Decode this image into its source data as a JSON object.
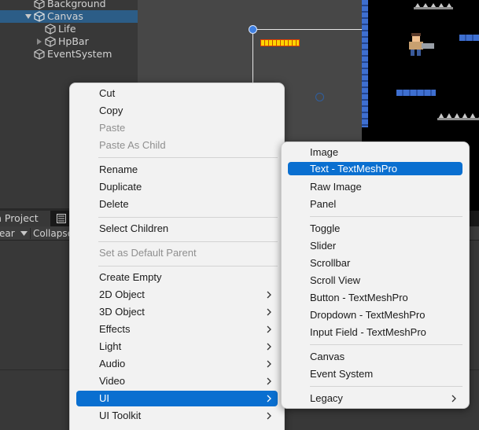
{
  "hierarchy": {
    "items": [
      {
        "label": "Background",
        "indent": 1,
        "selected": false,
        "foldout": "none"
      },
      {
        "label": "Canvas",
        "indent": 1,
        "selected": true,
        "foldout": "expanded"
      },
      {
        "label": "Life",
        "indent": 2,
        "selected": false,
        "foldout": "none"
      },
      {
        "label": "HpBar",
        "indent": 2,
        "selected": false,
        "foldout": "collapsed"
      },
      {
        "label": "EventSystem",
        "indent": 1,
        "selected": false,
        "foldout": "none"
      }
    ]
  },
  "tabs": {
    "project": "n Project",
    "console_icon": "console-icon"
  },
  "toolbar": {
    "clear_label": "ear",
    "collapse_label": "Collapse"
  },
  "context_menu": {
    "items": [
      {
        "label": "Cut",
        "enabled": true
      },
      {
        "label": "Copy",
        "enabled": true
      },
      {
        "label": "Paste",
        "enabled": false
      },
      {
        "label": "Paste As Child",
        "enabled": false
      },
      {
        "label": "Rename",
        "enabled": true
      },
      {
        "label": "Duplicate",
        "enabled": true
      },
      {
        "label": "Delete",
        "enabled": true
      },
      {
        "label": "Select Children",
        "enabled": true
      },
      {
        "label": "Set as Default Parent",
        "enabled": false
      },
      {
        "label": "Create Empty",
        "enabled": true
      },
      {
        "label": "2D Object",
        "enabled": true,
        "submenu": true
      },
      {
        "label": "3D Object",
        "enabled": true,
        "submenu": true
      },
      {
        "label": "Effects",
        "enabled": true,
        "submenu": true
      },
      {
        "label": "Light",
        "enabled": true,
        "submenu": true
      },
      {
        "label": "Audio",
        "enabled": true,
        "submenu": true
      },
      {
        "label": "Video",
        "enabled": true,
        "submenu": true
      },
      {
        "label": "UI",
        "enabled": true,
        "submenu": true,
        "highlighted": true
      },
      {
        "label": "UI Toolkit",
        "enabled": true,
        "submenu": true
      }
    ]
  },
  "ui_submenu": {
    "items": [
      {
        "label": "Image"
      },
      {
        "label": "Text - TextMeshPro",
        "highlighted": true
      },
      {
        "label": "Raw Image"
      },
      {
        "label": "Panel"
      },
      {
        "label": "Toggle"
      },
      {
        "label": "Slider"
      },
      {
        "label": "Scrollbar"
      },
      {
        "label": "Scroll View"
      },
      {
        "label": "Button - TextMeshPro"
      },
      {
        "label": "Dropdown - TextMeshPro"
      },
      {
        "label": "Input Field - TextMeshPro"
      },
      {
        "label": "Canvas"
      },
      {
        "label": "Event System"
      },
      {
        "label": "Legacy",
        "submenu": true
      }
    ]
  },
  "colors": {
    "highlight": "#0a6fd0",
    "selected_row": "#2c5d87",
    "editor_bg": "#383838",
    "menu_bg": "#f2f2f2"
  }
}
